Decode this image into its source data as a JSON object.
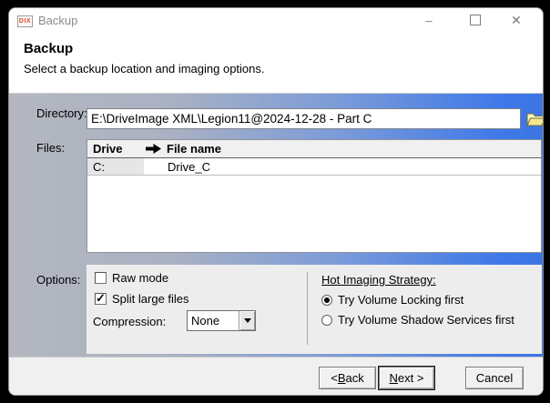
{
  "window": {
    "title": "Backup",
    "icon_text": "DIX",
    "controls": {
      "minimize": "–",
      "close": "✕"
    }
  },
  "header": {
    "title": "Backup",
    "subtitle": "Select a backup location and imaging options."
  },
  "directory": {
    "label": "Directory:",
    "value": "E:\\DriveImage XML\\Legion11@2024-12-28 - Part C",
    "browse_icon": "folder-icon"
  },
  "files": {
    "label": "Files:",
    "columns": {
      "drive": "Drive",
      "file_name": "File name"
    },
    "rows": [
      {
        "drive": "C:",
        "file_name": "Drive_C"
      }
    ]
  },
  "options": {
    "label": "Options:",
    "raw_mode": {
      "label": "Raw mode",
      "checked": false
    },
    "split_large_files": {
      "label": "Split large files",
      "checked": true
    },
    "compression": {
      "label": "Compression:",
      "value": "None"
    },
    "hot_imaging": {
      "heading": "Hot Imaging Strategy:",
      "choices": [
        {
          "label": "Try Volume Locking first",
          "selected": true
        },
        {
          "label": "Try Volume Shadow Services first",
          "selected": false
        }
      ]
    }
  },
  "buttons": {
    "back": {
      "prefix": "< ",
      "accesskey": "B",
      "rest": "ack"
    },
    "next": {
      "prefix": "",
      "accesskey": "N",
      "rest": "ext >"
    },
    "cancel": {
      "label": "Cancel"
    }
  },
  "colors": {
    "accent_blue": "#3c76e6",
    "panel_gray": "#b4b7bf",
    "options_bg": "#ededed",
    "title_text": "#8c8c8c",
    "icon_orange": "#e0481f"
  }
}
